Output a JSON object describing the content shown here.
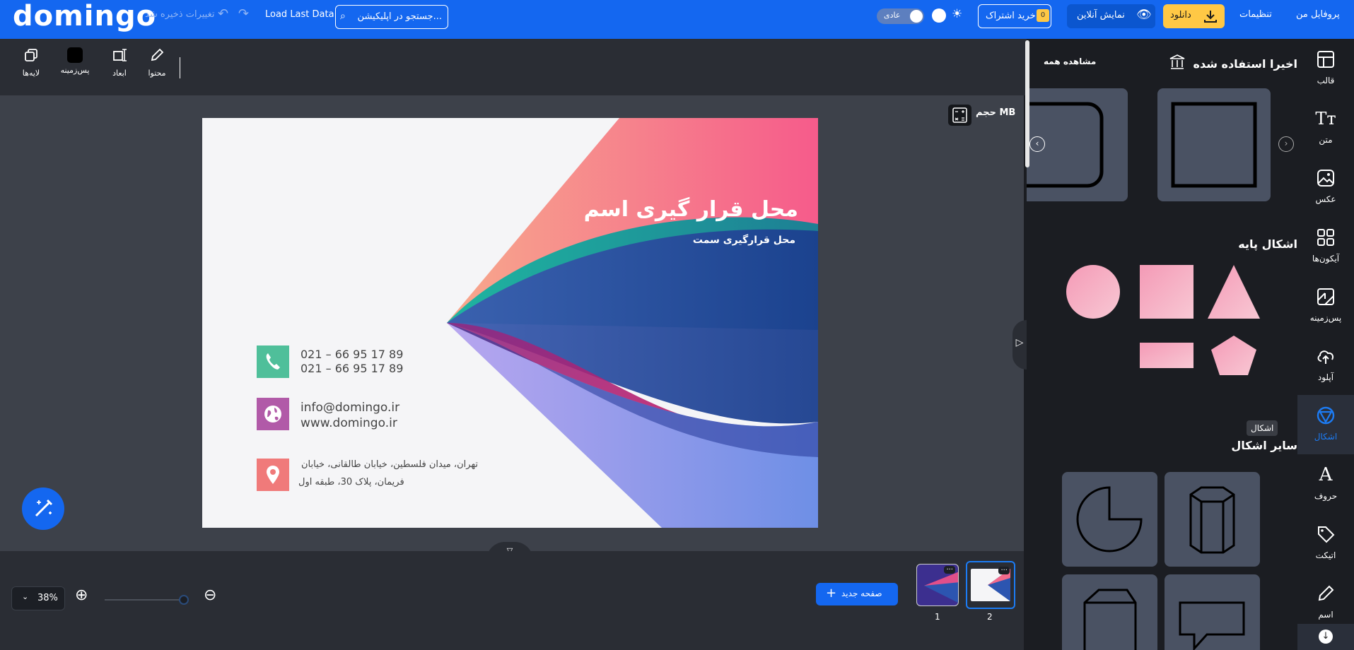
{
  "app": {
    "logo": "domingo"
  },
  "topbar": {
    "saved_status": "تغییرات ذخیره شد",
    "load_last": "Load Last Data",
    "search_placeholder": "جستجو در اپلیکیشن...",
    "mode_label": "عادی",
    "subscribe_label": "خرید اشتراک",
    "subscribe_badge": "0",
    "online_preview_label": "نمایش آنلاین",
    "download_label": "دانلود",
    "settings_label": "تنظیمات",
    "profile_label": "پروفایل من"
  },
  "rail": {
    "items": [
      {
        "label": "قالب",
        "icon": "template-icon"
      },
      {
        "label": "متن",
        "icon": "text-icon"
      },
      {
        "label": "عکس",
        "icon": "image-icon"
      },
      {
        "label": "آیکون‌ها",
        "icon": "icons-grid-icon"
      },
      {
        "label": "پس‌زمینه",
        "icon": "background-icon"
      },
      {
        "label": "آپلود",
        "icon": "upload-icon"
      },
      {
        "label": "اشکال",
        "icon": "shapes-icon"
      },
      {
        "label": "حروف",
        "icon": "letters-icon"
      },
      {
        "label": "اتیکت",
        "icon": "tag-icon"
      },
      {
        "label": "اسم",
        "icon": "pen-icon"
      }
    ],
    "tooltip": "اشکال",
    "active_color": "#1c7cf5"
  },
  "panel": {
    "recent_title": "اخیرا استفاده شده",
    "view_all": "مشاهده همه",
    "basic_title": "اشکال پایه",
    "other_title": "سایر اشکال"
  },
  "editbar": {
    "tools": [
      {
        "label": "محتوا",
        "icon": "edit-icon"
      },
      {
        "label": "ابعاد",
        "icon": "resize-icon"
      },
      {
        "label": "پس‌زمینه",
        "icon": "bg-color-icon"
      },
      {
        "label": "لایه‌ها",
        "icon": "layers-icon"
      }
    ]
  },
  "canvas": {
    "size_label": "حجم MB",
    "title": "محل قرار گیری اسم",
    "subtitle": "محل قرارگیری سمت",
    "phone1": "021 – 66 95 17 89",
    "phone2": "021 – 66 95 17 89",
    "email": "info@domingo.ir",
    "website": "www.domingo.ir",
    "address1": "تهران، میدان فلسطین، خیابان طالقانی، خیابان",
    "address2": "فریمان، پلاک 30، طبقه اول"
  },
  "bottom": {
    "zoom": "38%",
    "zoom_fraction": 0.38,
    "new_page": "صفحه جدید",
    "pages": [
      "1",
      "2"
    ],
    "thumb_menu": "···"
  },
  "colors": {
    "brand": "#1467f0",
    "download": "#ffc845",
    "shape_pink_start": "#f9a1be",
    "shape_pink_end": "#f9c0cf"
  }
}
